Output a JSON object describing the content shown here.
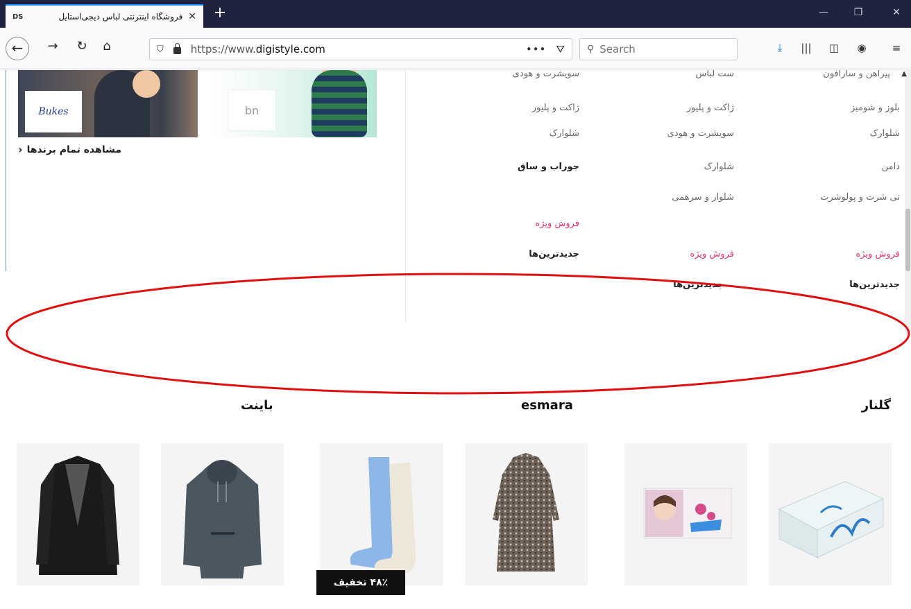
{
  "browser": {
    "tab_favicon": "DS",
    "tab_title": "فروشگاه اینترنتی لباس دیجی‌استایل",
    "tab_close": "✕",
    "new_tab": "+",
    "url_prefix": "https://www.",
    "url_domain": "digistyle.com",
    "page_actions": "•••",
    "search_placeholder": "Search"
  },
  "brands": {
    "bukes_logo": "Bukes",
    "bn_logo": "bn",
    "all_brands_link": "مشاهده تمام برندها"
  },
  "menu": {
    "col1": [
      "پیراهن و سارافون",
      "بلوز و شومیز",
      "شلوارک",
      "دامن",
      "تی شرت و پولوشرت",
      "فروش ویژه",
      "جدیدترین‌ها"
    ],
    "col2": [
      "ست لباس",
      "ژاکت و پلیور",
      "سویشرت و هودی",
      "شلوارک",
      "شلوار و سرهمی",
      "فروش ویژه",
      "جدیدترین‌ها"
    ],
    "col3": [
      "سویشرت و هودی",
      "ژاکت و پلیور",
      "شلوارک",
      "جوراب و ساق",
      "فروش ویژه",
      "جدیدترین‌ها"
    ]
  },
  "sections": {
    "golnar": "گلنار",
    "esmara": "esmara",
    "bayant": "باینت"
  },
  "products": {
    "discount_badge": "۴۸٪ تخفیف",
    "tissue_brand": "گلنار"
  },
  "colors": {
    "accent_red": "#e5326b",
    "annotation_red": "#e01010",
    "titlebar": "#202340"
  }
}
